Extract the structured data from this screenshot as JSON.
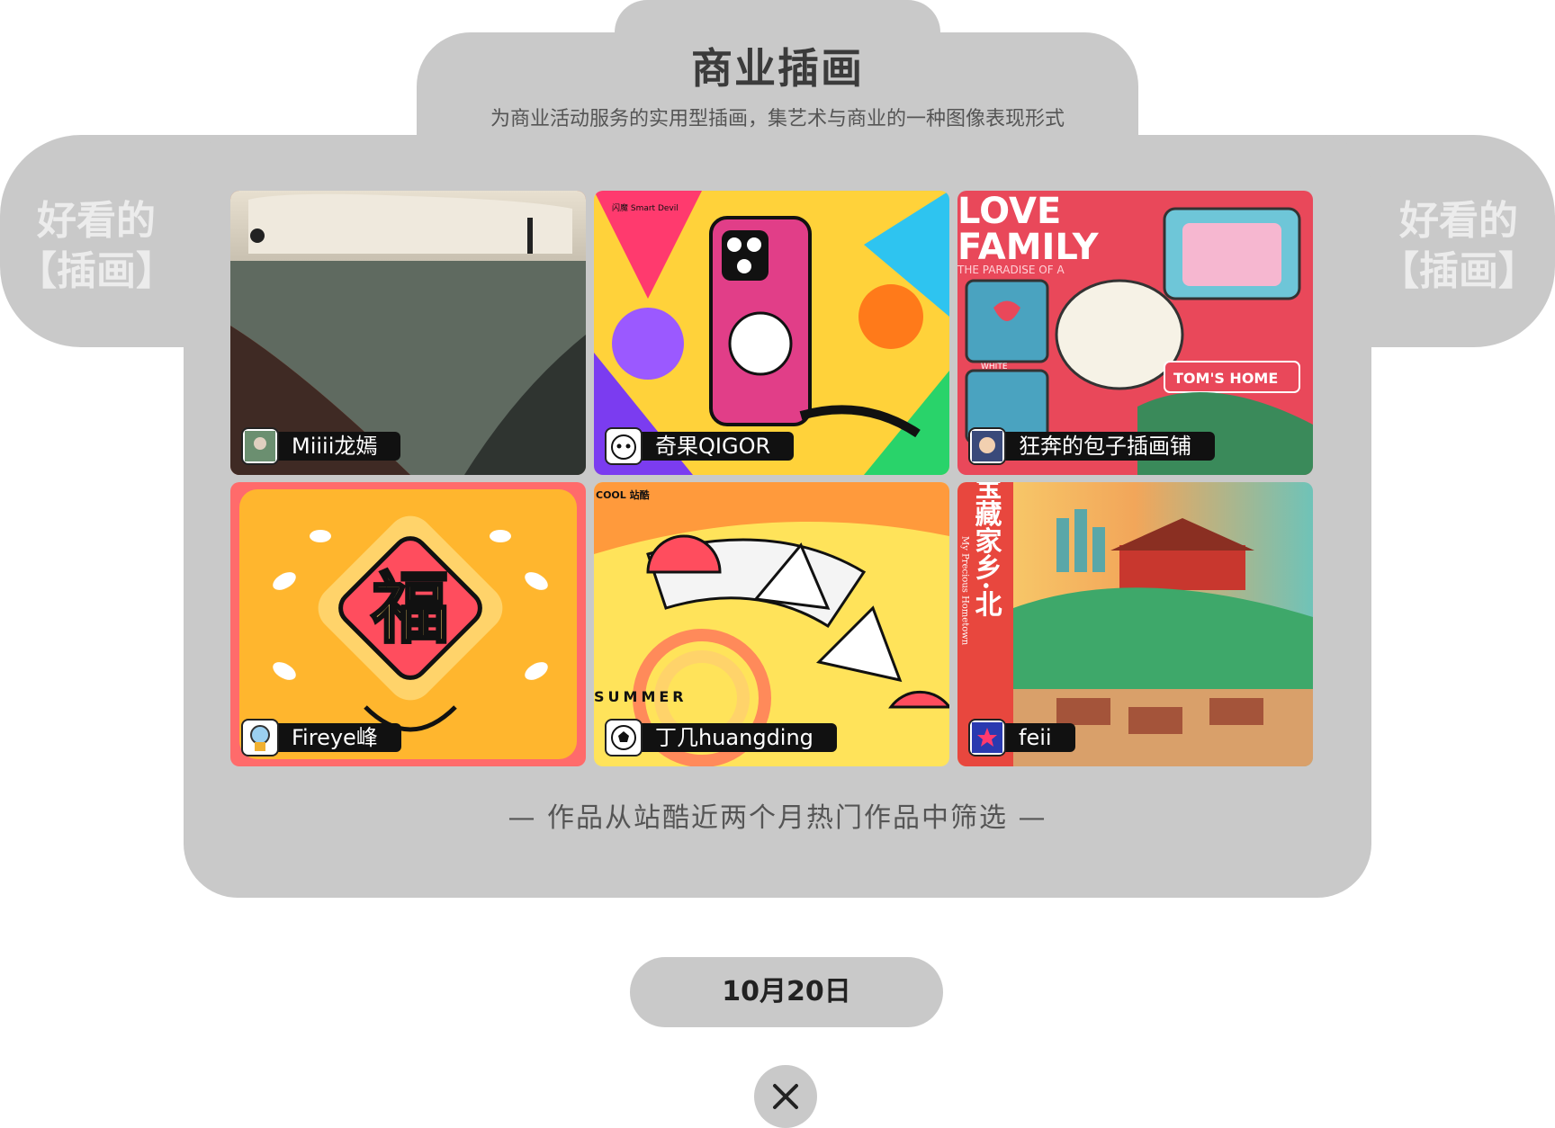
{
  "header": {
    "title": "商业插画",
    "subtitle": "为商业活动服务的实用型插画，集艺术与商业的一种图像表现形式"
  },
  "side_label": {
    "line1": "好看的",
    "line2": "【插画】"
  },
  "gallery": [
    {
      "author": "Miiii龙嫣",
      "avatar_icon": "portrait-avatar-icon"
    },
    {
      "author": "奇果QIGOR",
      "avatar_icon": "cat-face-avatar-icon"
    },
    {
      "author": "狂奔的包子插画铺",
      "avatar_icon": "character-avatar-icon"
    },
    {
      "author": "Fireye峰",
      "avatar_icon": "astronaut-avatar-icon"
    },
    {
      "author": "丁几huangding",
      "avatar_icon": "soccer-ball-avatar-icon"
    },
    {
      "author": "feii",
      "avatar_icon": "star-avatar-icon"
    }
  ],
  "artwork_text": {
    "card2_brand": "闪魔 Smart Devil",
    "card3_love": "LOVE",
    "card3_family": "FAMILY",
    "card3_paradise": "THE PARADISE OF A",
    "card3_white": "WHITE",
    "card3_home": "TOM'S HOME",
    "card4_fu": "福",
    "card5_summer": "SUMMER",
    "card5_brand": "COOL 站酷",
    "card6_title": "我的宝藏家乡·北",
    "card6_en": "My Precious Hometown"
  },
  "footer": {
    "note": "—    作品从站酷近两个月热门作品中筛选    —",
    "date": "10月20日"
  },
  "colors": {
    "panel": "#c9c9c9",
    "title": "#3b3b3b",
    "side_text": "#ececec"
  }
}
